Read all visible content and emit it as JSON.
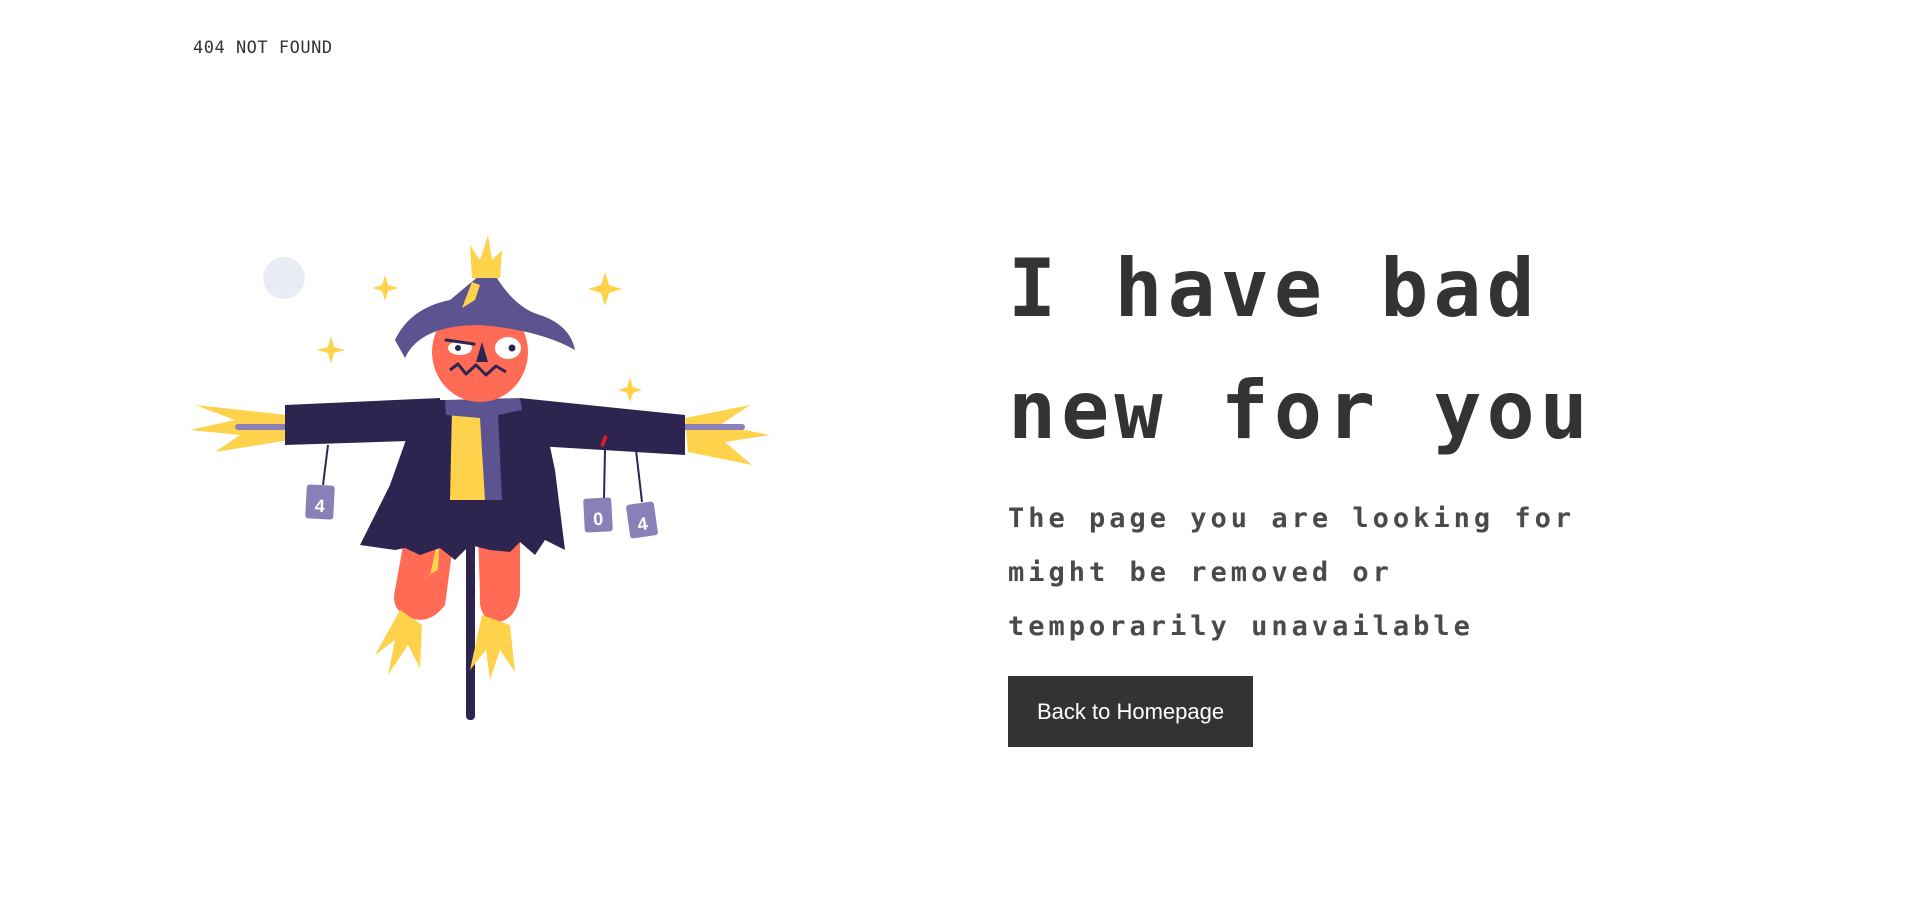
{
  "header": {
    "label": "404 NOT FOUND"
  },
  "illustration": {
    "icon": "scarecrow-illustration",
    "can_labels": [
      "4",
      "0",
      "4"
    ],
    "colors": {
      "coat": "#2d2550",
      "hat": "#5c5490",
      "face": "#ff6b55",
      "straw": "#ffd24c",
      "moon": "#e9ecf5",
      "can": "#8a80b8"
    }
  },
  "main": {
    "headline_lines": [
      "I have bad",
      "new for you"
    ],
    "message_lines": [
      "The page you are looking for",
      "might be removed or",
      "temporarily unavailable"
    ],
    "button_label": "Back to Homepage"
  },
  "theme": {
    "text": "#333333",
    "button_bg": "#333333",
    "button_text": "#ffffff"
  }
}
